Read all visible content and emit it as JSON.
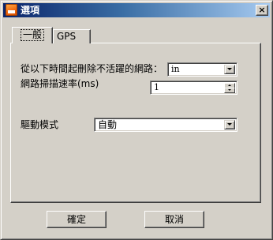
{
  "window": {
    "title": "選項",
    "close_glyph": "×",
    "icon": "app-orange-icon"
  },
  "tabs": [
    {
      "label": "一般",
      "active": true
    },
    {
      "label": "GPS",
      "active": false
    }
  ],
  "general": {
    "remove_inactive_label": "從以下時間起刪除不活躍的網路：",
    "remove_inactive_value": "in",
    "scan_rate_label": "網路掃描速率(ms)",
    "scan_rate_value": "1",
    "driver_mode_label": "驅動模式",
    "driver_mode_value": "自動"
  },
  "buttons": {
    "ok": "確定",
    "cancel": "取消"
  },
  "colors": {
    "titlebar_start": "#0a246a",
    "titlebar_end": "#a6caf0",
    "face": "#d4d0c8"
  }
}
